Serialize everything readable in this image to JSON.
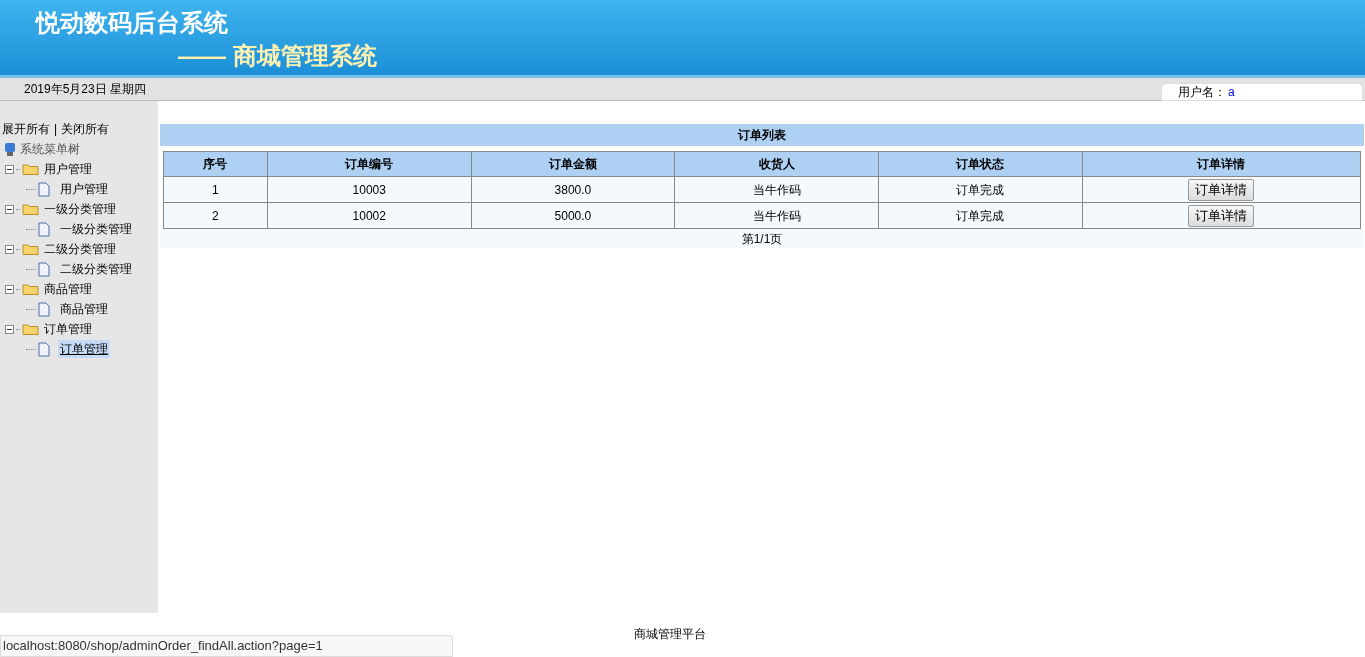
{
  "header": {
    "title": "悦动数码后台系统",
    "subtitle": "—— 商城管理系统"
  },
  "info_bar": {
    "date": "2019年5月23日 星期四",
    "user_label": "用户名：",
    "user_value": "a"
  },
  "sidebar": {
    "expand_all": "展开所有",
    "separator": "|",
    "collapse_all": "关闭所有",
    "tree_root": "系统菜单树",
    "items": [
      {
        "label": "用户管理",
        "expanded": true,
        "children": [
          {
            "label": "用户管理",
            "selected": false
          }
        ]
      },
      {
        "label": "一级分类管理",
        "expanded": true,
        "children": [
          {
            "label": "一级分类管理",
            "selected": false
          }
        ]
      },
      {
        "label": "二级分类管理",
        "expanded": true,
        "children": [
          {
            "label": "二级分类管理",
            "selected": false
          }
        ]
      },
      {
        "label": "商品管理",
        "expanded": true,
        "children": [
          {
            "label": "商品管理",
            "selected": false
          }
        ]
      },
      {
        "label": "订单管理",
        "expanded": true,
        "children": [
          {
            "label": "订单管理",
            "selected": true
          }
        ]
      }
    ]
  },
  "table": {
    "title": "订单列表",
    "columns": [
      "序号",
      "订单编号",
      "订单金额",
      "收货人",
      "订单状态",
      "订单详情"
    ],
    "rows": [
      {
        "cells": [
          "1",
          "10003",
          "3800.0",
          "当牛作码",
          "订单完成"
        ],
        "action": "订单详情"
      },
      {
        "cells": [
          "2",
          "10002",
          "5000.0",
          "当牛作码",
          "订单完成"
        ],
        "action": "订单详情"
      }
    ],
    "pagination": "第1/1页"
  },
  "footer": "商城管理平台",
  "status_bar": "localhost:8080/shop/adminOrder_findAll.action?page=1"
}
